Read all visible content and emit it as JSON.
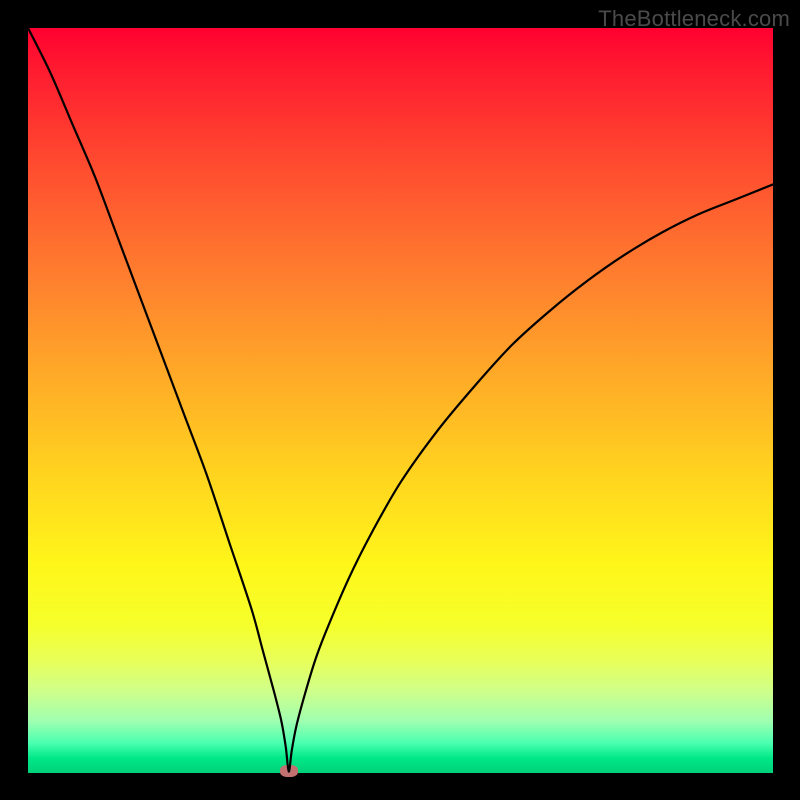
{
  "watermark": "TheBottleneck.com",
  "chart_data": {
    "type": "line",
    "title": "",
    "xlabel": "",
    "ylabel": "",
    "xlim": [
      0,
      100
    ],
    "ylim": [
      0,
      100
    ],
    "grid": false,
    "legend": false,
    "min_point": {
      "x": 35,
      "y": 0
    },
    "series": [
      {
        "name": "bottleneck-curve",
        "x": [
          0,
          3,
          6,
          9,
          12,
          15,
          18,
          21,
          24,
          27,
          30,
          31.5,
          33,
          34,
          34.6,
          35,
          35.4,
          36,
          37,
          38.5,
          40,
          43,
          46,
          50,
          55,
          60,
          65,
          70,
          75,
          80,
          85,
          90,
          95,
          100
        ],
        "y": [
          100,
          94,
          87,
          80,
          72,
          64,
          56,
          48,
          40,
          31,
          22,
          16.5,
          11,
          7,
          3.5,
          0.2,
          3,
          6.2,
          10,
          15,
          19,
          26,
          32,
          39,
          46,
          52,
          57.5,
          62,
          66,
          69.5,
          72.5,
          75,
          77,
          79
        ]
      }
    ]
  }
}
